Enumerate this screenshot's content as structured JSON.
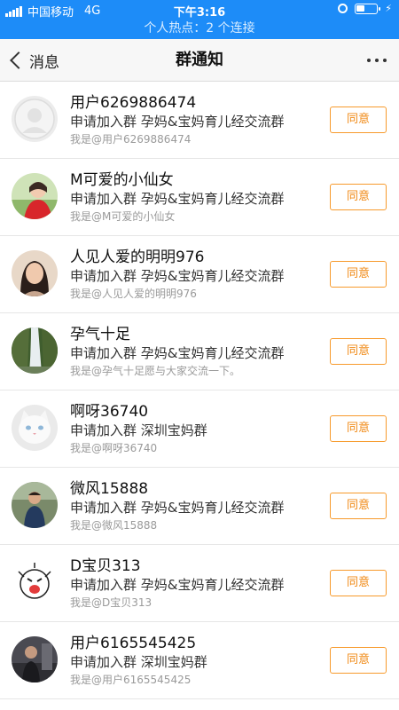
{
  "status_bar": {
    "carrier": "中国移动",
    "network": "4G",
    "time": "下午3:16",
    "battery_level": 0.45
  },
  "hotspot": {
    "text": "个人热点：2 个连接"
  },
  "nav": {
    "back_label": "消息",
    "title": "群通知"
  },
  "requests": [
    {
      "name": "用户6269886474",
      "request": "申请加入群 孕妈&宝妈育儿经交流群",
      "note": "我是@用户6269886474",
      "button": "同意",
      "avatar": "default-avatar"
    },
    {
      "name": "M可爱的小仙女",
      "request": "申请加入群 孕妈&宝妈育儿经交流群",
      "note": "我是@M可爱的小仙女",
      "button": "同意",
      "avatar": "girl-red-dress"
    },
    {
      "name": "人见人爱的明明976",
      "request": "申请加入群 孕妈&宝妈育儿经交流群",
      "note": "我是@人见人爱的明明976",
      "button": "同意",
      "avatar": "woman-portrait"
    },
    {
      "name": "孕气十足",
      "request": "申请加入群 孕妈&宝妈育儿经交流群",
      "note": "我是@孕气十足愿与大家交流一下。",
      "button": "同意",
      "avatar": "waterfall"
    },
    {
      "name": "啊呀36740",
      "request": "申请加入群 深圳宝妈群",
      "note": "我是@啊呀36740",
      "button": "同意",
      "avatar": "white-cat"
    },
    {
      "name": "微风15888",
      "request": "申请加入群 孕妈&宝妈育儿经交流群",
      "note": "我是@微风15888",
      "button": "同意",
      "avatar": "man-outdoor"
    },
    {
      "name": "D宝贝313",
      "request": "申请加入群 孕妈&宝妈育儿经交流群",
      "note": "我是@D宝贝313",
      "button": "同意",
      "avatar": "cartoon-face"
    },
    {
      "name": "用户6165545425",
      "request": "申请加入群 深圳宝妈群",
      "note": "我是@用户6165545425",
      "button": "同意",
      "avatar": "man-dark-photo"
    }
  ],
  "colors": {
    "accent_blue": "#1d8cf8",
    "button_orange": "#f08a16"
  }
}
